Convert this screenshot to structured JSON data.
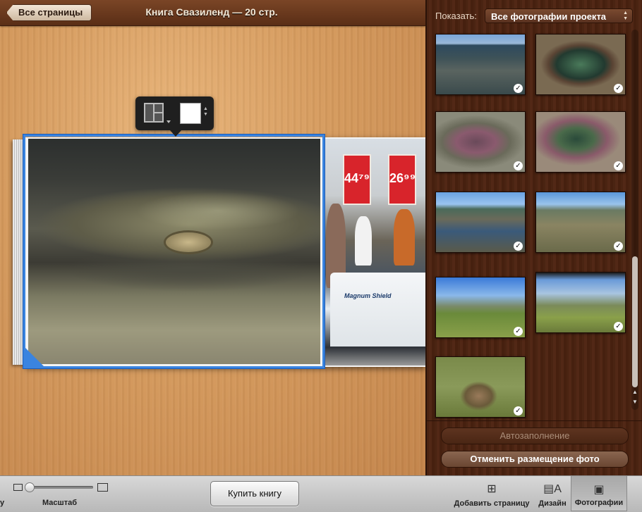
{
  "header": {
    "back_label": "Все страницы",
    "title": "Книга Свазиленд — 20 стр."
  },
  "right_page": {
    "sign_left": "44⁷⁹",
    "sign_right": "26⁹⁹",
    "van_text": "Magnum Shield"
  },
  "panel": {
    "show_label": "Показать:",
    "show_value": "Все фотографии проекта",
    "autofill_label": "Автозаполнение",
    "unplace_label": "Отменить размещение фото",
    "thumbnails": [
      {
        "name": "rocky-shore",
        "checked": true
      },
      {
        "name": "tide-pool",
        "checked": true
      },
      {
        "name": "purple-rock-pool",
        "checked": true
      },
      {
        "name": "green-rock-pool",
        "checked": true
      },
      {
        "name": "coast-blue-sky",
        "checked": true
      },
      {
        "name": "rocky-beach",
        "checked": true
      },
      {
        "name": "hikers-grassland",
        "checked": true
      },
      {
        "name": "grassland-sign",
        "checked": true
      },
      {
        "name": "kudu-antelope",
        "checked": true
      }
    ]
  },
  "toolbar": {
    "left_edge_text": "у",
    "zoom_label": "Масштаб",
    "buy_label": "Купить книгу",
    "add_page_label": "Добавить страницу",
    "design_label": "Дизайн",
    "photos_label": "Фотографии"
  },
  "colors": {
    "selection_blue": "#3a84e0",
    "wood_light": "#d59a5d",
    "panel_wood": "#4a2412"
  }
}
